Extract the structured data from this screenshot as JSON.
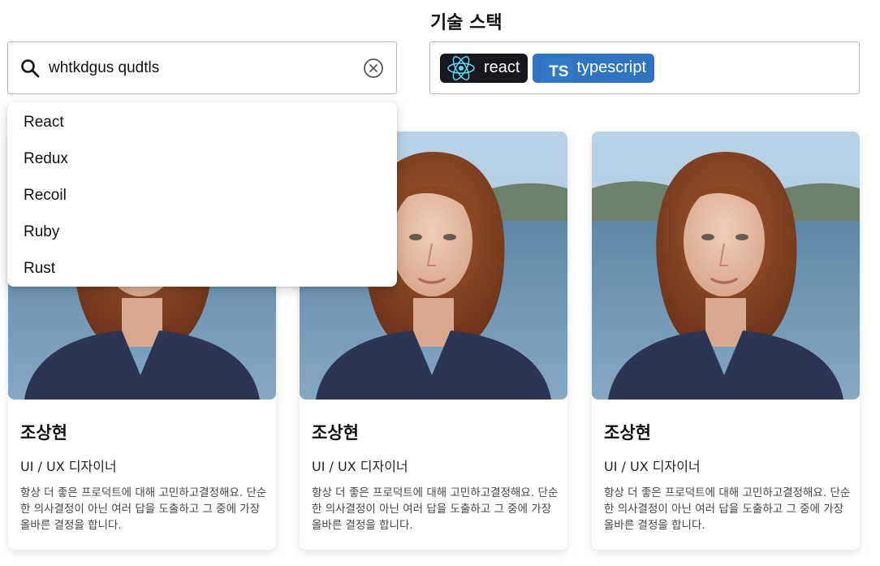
{
  "search": {
    "value": "whtkdgus qudtls",
    "placeholder": ""
  },
  "dropdown": {
    "options": [
      "React",
      "Redux",
      "Recoil",
      "Ruby",
      "Rust"
    ]
  },
  "tech_stack": {
    "title": "기술 스택",
    "chips": [
      {
        "label": "react",
        "icon": "react-logo-icon",
        "bg": "#16181d"
      },
      {
        "label": "typescript",
        "logo_text": "TS",
        "icon": "typescript-logo-icon",
        "bg": "#2f74c0"
      }
    ]
  },
  "cards": [
    {
      "name": "조상현",
      "role": "UI / UX 디자이너",
      "description": "항상 더 좋은 프로덕트에 대해 고민하고결정해요. 단순한 의사결정이 아닌 여러 답을 도출하고 그 중에 가장 올바른 결정을 합니다."
    },
    {
      "name": "조상현",
      "role": "UI / UX 디자이너",
      "description": "항상 더 좋은 프로덕트에 대해 고민하고결정해요. 단순한 의사결정이 아닌 여러 답을 도출하고 그 중에 가장 올바른 결정을 합니다."
    },
    {
      "name": "조상현",
      "role": "UI / UX 디자이너",
      "description": "항상 더 좋은 프로덕트에 대해 고민하고결정해요. 단순한 의사결정이 아닌 여러 답을 도출하고 그 중에 가장 올바른 결정을 합니다."
    }
  ],
  "colors": {
    "border": "#b5b5b5",
    "react_chip": "#16181d",
    "react_logo": "#61dafb",
    "typescript_chip": "#2f74c0"
  }
}
